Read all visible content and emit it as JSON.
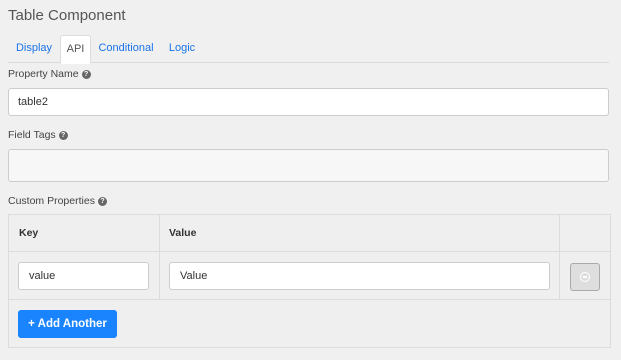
{
  "title": "Table Component",
  "tabs": [
    {
      "label": "Display"
    },
    {
      "label": "API"
    },
    {
      "label": "Conditional"
    },
    {
      "label": "Logic"
    }
  ],
  "property_name": {
    "label": "Property Name",
    "value": "table2"
  },
  "field_tags": {
    "label": "Field Tags",
    "value": ""
  },
  "custom_properties": {
    "label": "Custom Properties",
    "columns": [
      "Key",
      "Value"
    ],
    "rows": [
      {
        "key": "value",
        "value": "Value"
      }
    ],
    "add_label": "Add Another"
  },
  "help_glyph": "?",
  "plus_glyph": "+",
  "colors": {
    "accent": "#1a84ff",
    "link": "#1a73e8",
    "background": "#f0f0f0"
  }
}
